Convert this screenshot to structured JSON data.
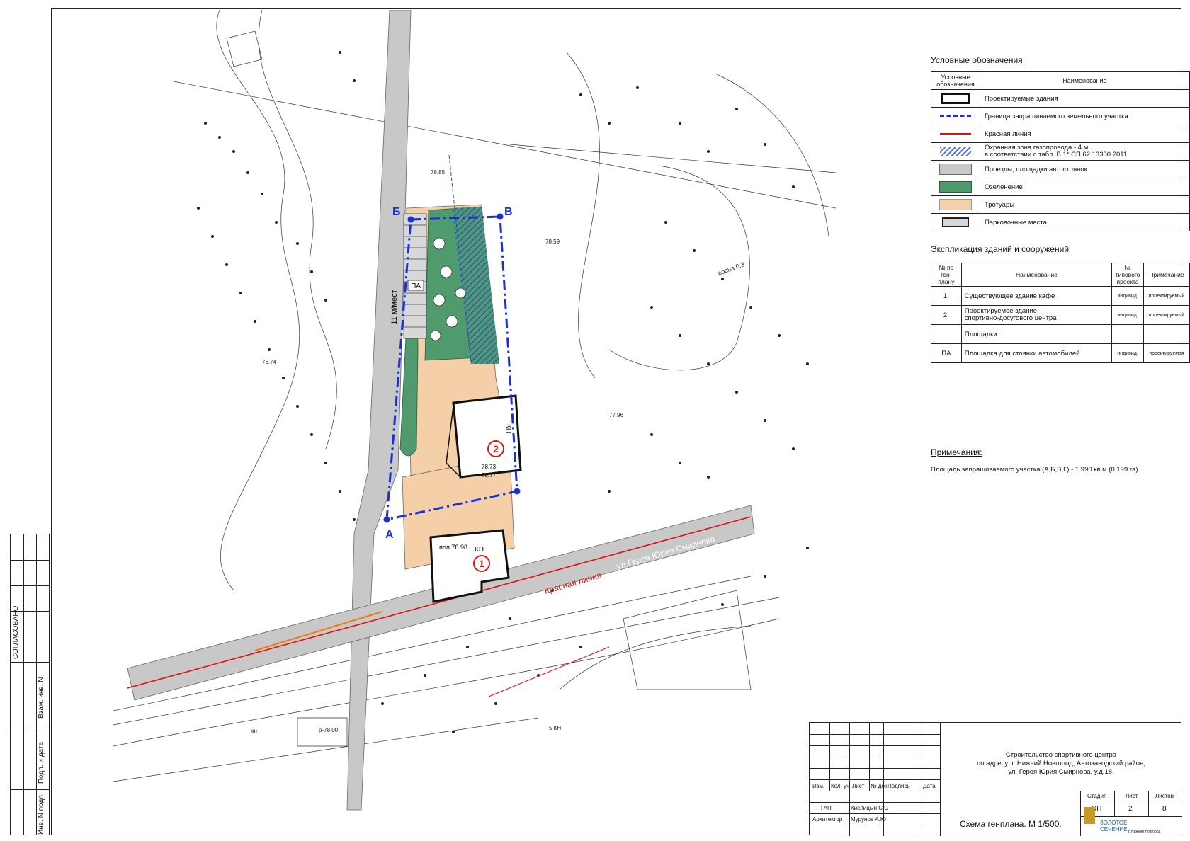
{
  "map": {
    "labels": {
      "point_a": "А",
      "point_b": "Б",
      "point_v": "В",
      "parking_label": "ПА",
      "parking_count": "11 м/мест",
      "building1_number": "1",
      "building2_number": "2",
      "building1_kh": "КН",
      "building2_kh": "КН",
      "building1_level": "пол 78.98",
      "building2_level1": "78.73",
      "building2_level2": "78.77",
      "street_name": "ул.Героя Юрия Смирнова",
      "red_line_label": "Красная линия",
      "survey_kh": "кн",
      "survey_kn": "5 КН",
      "survey_sosna": "сосна 0,3",
      "survey_gaz": "р-78.00",
      "survey_elev1": "78.85",
      "survey_elev2": "78.59",
      "survey_elev3": "77.96",
      "survey_elev4": "76.74"
    },
    "colors": {
      "roads": "#c8c8c8",
      "green": "#4f9b6d",
      "sidewalk": "#f5cfa8",
      "boundary": "#1a2fd6",
      "red_line": "#e01010"
    }
  },
  "legend": {
    "title": "Условные обозначения",
    "header_symbol": "Условные обозначения",
    "header_name": "Наименование",
    "items": [
      {
        "name": "Проектируемые здания",
        "icon": "building-symbol"
      },
      {
        "name": "Граница запрашиваемого земельного участка",
        "icon": "boundary-line"
      },
      {
        "name": "Красная линия",
        "icon": "red-line"
      },
      {
        "name": "Охранная зона газопровода - 4 м.",
        "name2": "в соответствии с табл. В.1* СП 62.13330.2011",
        "icon": "gas-zone-hatch"
      },
      {
        "name": "Проезды, площадки автостоянок",
        "icon": "grey-fill"
      },
      {
        "name": "Озеленение",
        "icon": "green-fill"
      },
      {
        "name": "Тротуары",
        "icon": "peach-fill"
      },
      {
        "name": "Парковочные места",
        "icon": "parking-fill"
      }
    ]
  },
  "explication": {
    "title": "Экспликация зданий и сооружений",
    "headers": {
      "num": "№ по ген- плану",
      "name": "Наименование",
      "project": "№ типового проекта",
      "note": "Примечание"
    },
    "rows": [
      {
        "num": "1.",
        "name": "Существующее здание кафе",
        "project": "индивид.",
        "note": "проектируемый"
      },
      {
        "num": "2.",
        "name": "Проектируемое здание",
        "name2": "спортивно-досугового центра",
        "project": "индивид.",
        "note": "проектируемый"
      },
      {
        "num": "",
        "name": "Площадки:",
        "project": "",
        "note": ""
      },
      {
        "num": "ПА",
        "name": "Площадка для стоянки автомобилей",
        "project": "индивид.",
        "note": "проектируемая"
      }
    ]
  },
  "notes": {
    "title": "Примечания:",
    "text": "Площадь запрашиваемого участка (А,Б,В,Г) - 1 990 кв.м (0,199 га)"
  },
  "title_block": {
    "project_line1": "Строительство спортивного центра",
    "project_line2": "по адресу:  г. Нижний Новгород, Автозаводский район,",
    "project_line3": "ул. Героя Юрия Смирнова, у.д.18.",
    "drawing_title": "Схема генплана. М 1/500.",
    "headers": {
      "izm": "Изм.",
      "kol": "Кол. уч",
      "list": "Лист",
      "ndok": "№ док.",
      "podpis": "Подпись",
      "data": "Дата"
    },
    "stage_label": "Стадия",
    "sheet_label": "Лист",
    "sheets_label": "Листов",
    "stage": "ЭП",
    "sheet": "2",
    "sheets": "8",
    "role1": "ГАП",
    "name1": "Кислицын С.С",
    "role2": "Архитектор",
    "name2": "Мурунов А.Ю",
    "company_line1": "ЗОЛОТОЕ",
    "company_line2": "СЕЧЕНИЕ",
    "company_city": "г. Нижний Новгород"
  },
  "side_stamp": {
    "agreed": "СОГЛАСОВАНО",
    "vzam": "Взам. инв. N",
    "podp_data": "Подп. и дата",
    "inv": "Инв. N подл."
  }
}
